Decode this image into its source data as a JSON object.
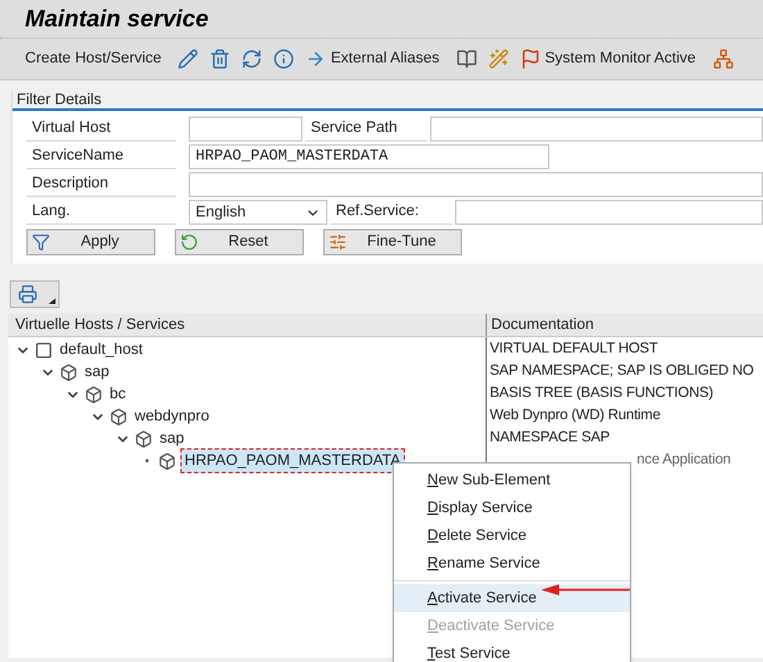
{
  "window": {
    "title": "Maintain service"
  },
  "toolbar": [
    {
      "kind": "text",
      "label": "Create Host/Service"
    },
    {
      "kind": "icon"
    },
    {
      "kind": "icon"
    },
    {
      "kind": "icon"
    },
    {
      "kind": "icon"
    },
    {
      "kind": "icon-text",
      "label": "External Aliases"
    },
    {
      "kind": "icon"
    },
    {
      "kind": "icon"
    },
    {
      "kind": "icon-text",
      "label": "System Monitor Active"
    },
    {
      "kind": "icon"
    }
  ],
  "filter": {
    "title": "Filter Details",
    "virtual_host": {
      "label": "Virtual Host"
    },
    "service_path": {
      "label": "Service Path"
    },
    "service_name": {
      "label": "ServiceName",
      "value": "HRPAO_PAOM_MASTERDATA"
    },
    "description": {
      "label": "Description"
    },
    "lang": {
      "label": "Lang.",
      "value": "English"
    },
    "ref_service": {
      "label": "Ref.Service:"
    },
    "buttons": [
      {
        "label": "Apply"
      },
      {
        "label": "Reset"
      },
      {
        "label": "Fine-Tune"
      }
    ]
  },
  "tree": {
    "columns": [
      "Virtuelle Hosts / Services",
      "Documentation"
    ],
    "nodes": [
      {
        "label": "default_host",
        "doc": "VIRTUAL DEFAULT HOST",
        "expanded": true,
        "selected": false,
        "children": [
          {
            "label": "sap",
            "doc": "SAP NAMESPACE; SAP IS OBLIGED NO",
            "expanded": true,
            "selected": false,
            "children": [
              {
                "label": "bc",
                "doc": "BASIS TREE (BASIS FUNCTIONS)",
                "expanded": true,
                "selected": false,
                "children": [
                  {
                    "label": "webdynpro",
                    "doc": "Web Dynpro (WD) Runtime",
                    "expanded": true,
                    "selected": false,
                    "children": [
                      {
                        "label": "sap",
                        "doc": "NAMESPACE SAP",
                        "expanded": true,
                        "selected": false,
                        "children": [
                          {
                            "label": "HRPAO_PAOM_MASTERDATA",
                            "doc": "nce Application",
                            "selected": true
                          }
                        ]
                      }
                    ]
                  }
                ]
              }
            ]
          }
        ]
      }
    ]
  },
  "context_menu": {
    "groups": [
      [
        {
          "label": "New Sub-Element",
          "disabled": false,
          "selected": false
        },
        {
          "label": "Display Service",
          "disabled": false,
          "selected": false
        },
        {
          "label": "Delete Service",
          "disabled": false,
          "selected": false
        },
        {
          "label": "Rename Service",
          "disabled": false,
          "selected": false
        }
      ],
      [
        {
          "label": "Activate Service",
          "disabled": false,
          "selected": true
        },
        {
          "label": "Deactivate Service",
          "disabled": true,
          "selected": false
        },
        {
          "label": "Test Service",
          "disabled": false,
          "selected": false
        }
      ]
    ]
  }
}
